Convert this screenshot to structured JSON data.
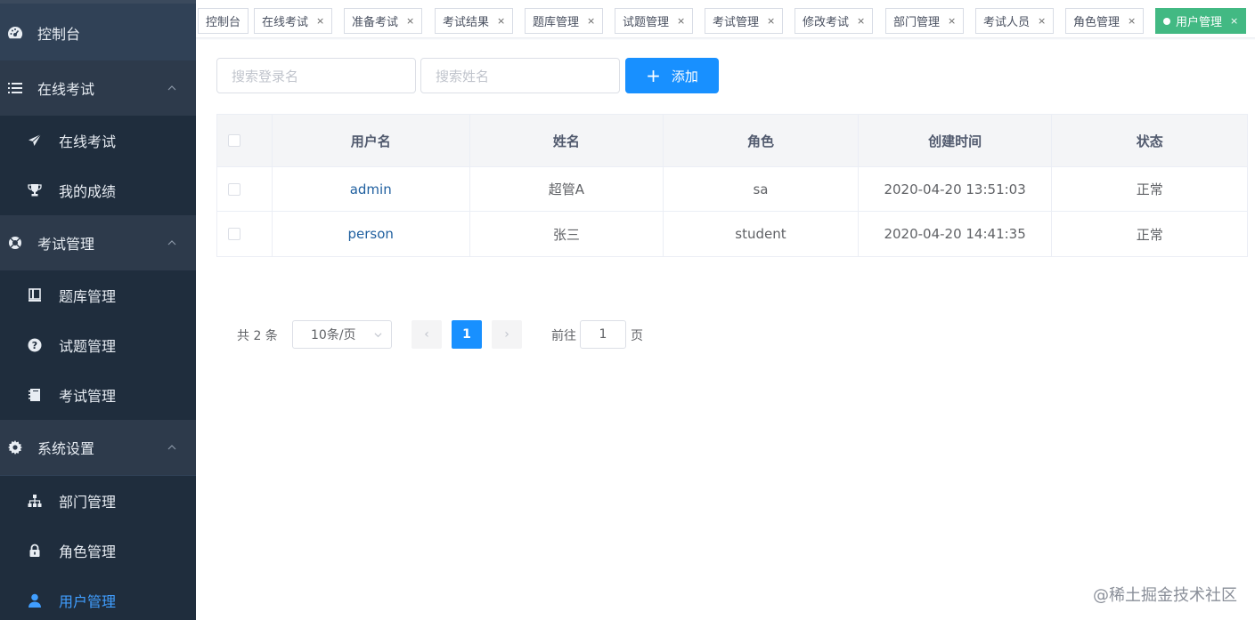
{
  "sidebar": {
    "items": [
      {
        "label": "控制台",
        "icon": "dashboard-icon"
      },
      {
        "label": "在线考试",
        "icon": "list-icon"
      },
      {
        "label": "在线考试",
        "icon": "paper-plane-icon"
      },
      {
        "label": "我的成绩",
        "icon": "trophy-icon"
      },
      {
        "label": "考试管理",
        "icon": "lifebuoy-icon"
      },
      {
        "label": "题库管理",
        "icon": "book-icon"
      },
      {
        "label": "试题管理",
        "icon": "question-icon"
      },
      {
        "label": "考试管理",
        "icon": "notebook-icon"
      },
      {
        "label": "系统设置",
        "icon": "gear-icon"
      },
      {
        "label": "部门管理",
        "icon": "sitemap-icon"
      },
      {
        "label": "角色管理",
        "icon": "lock-icon"
      },
      {
        "label": "用户管理",
        "icon": "user-icon"
      }
    ],
    "active_color": "#409eff"
  },
  "tags": [
    {
      "label": "控制台",
      "closable": false
    },
    {
      "label": "在线考试",
      "closable": true
    },
    {
      "label": "准备考试",
      "closable": true
    },
    {
      "label": "考试结果",
      "closable": true
    },
    {
      "label": "题库管理",
      "closable": true
    },
    {
      "label": "试题管理",
      "closable": true
    },
    {
      "label": "考试管理",
      "closable": true
    },
    {
      "label": "修改考试",
      "closable": true
    },
    {
      "label": "部门管理",
      "closable": true
    },
    {
      "label": "考试人员",
      "closable": true
    },
    {
      "label": "角色管理",
      "closable": true
    },
    {
      "label": "用户管理",
      "closable": true,
      "active": true
    }
  ],
  "tag_close_glyph": "×",
  "search": {
    "login_placeholder": "搜索登录名",
    "name_placeholder": "搜索姓名",
    "add_label": "添加",
    "add_glyph": "+"
  },
  "table": {
    "headers": [
      "用户名",
      "姓名",
      "角色",
      "创建时间",
      "状态"
    ],
    "rows": [
      {
        "username": "admin",
        "name": "超管A",
        "role": "sa",
        "created": "2020-04-20 13:51:03",
        "status": "正常"
      },
      {
        "username": "person",
        "name": "张三",
        "role": "student",
        "created": "2020-04-20 14:41:35",
        "status": "正常"
      }
    ]
  },
  "pagination": {
    "total": "共 2 条",
    "page_size": "10条/页",
    "current": "1",
    "goto_label": "前往",
    "goto_value": "1",
    "page_suffix": "页",
    "prev_glyph": "‹",
    "next_glyph": "›"
  },
  "watermark": "@稀土掘金技术社区",
  "colors": {
    "sidebar_bg": "#304156",
    "primary": "#1890ff",
    "active_tag": "#42b983"
  }
}
